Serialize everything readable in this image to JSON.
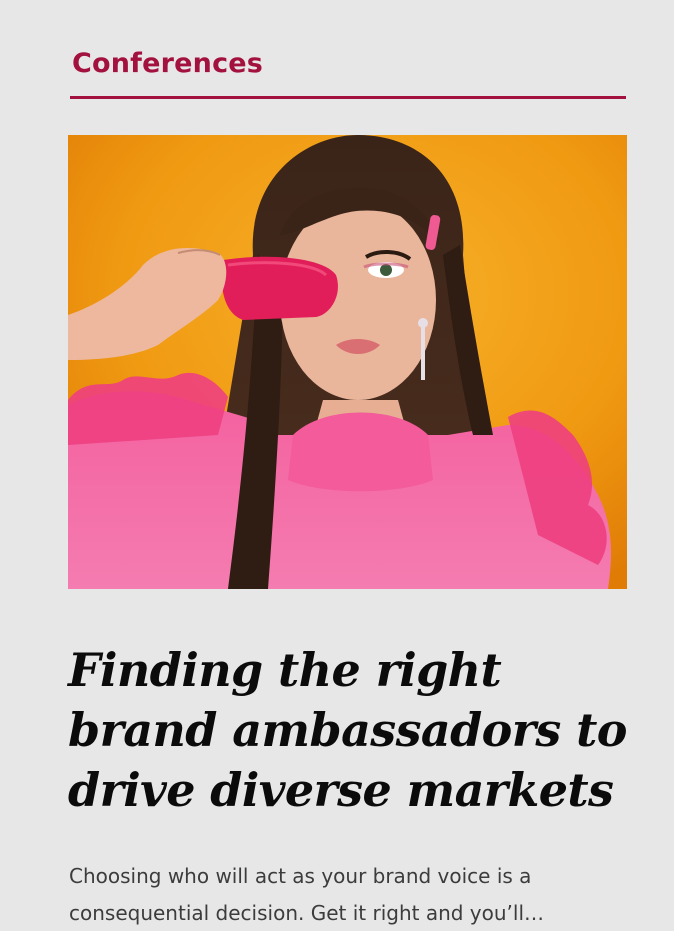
{
  "section": {
    "label": "Conferences"
  },
  "article": {
    "image_alt": "Woman in pink ruffled top holding a pink ice lolly over one eye against an orange background",
    "headline": "Finding the right brand ambassadors to drive diverse markets",
    "excerpt": "Choosing who will act as your brand voice is a consequential decision. Get it right and you’ll…"
  },
  "colors": {
    "accent": "#a3123f",
    "background": "#e8e7e7",
    "headline": "#0b0b0b",
    "body": "#3c3c3c"
  }
}
